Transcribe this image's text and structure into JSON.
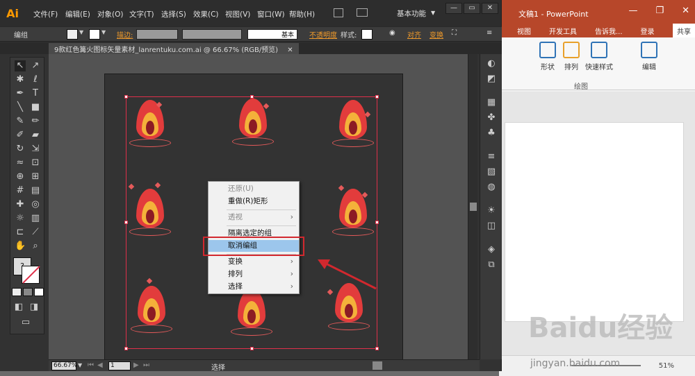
{
  "illustrator": {
    "logo": "Ai",
    "menu": [
      "文件(F)",
      "编辑(E)",
      "对象(O)",
      "文字(T)",
      "选择(S)",
      "效果(C)",
      "视图(V)",
      "窗口(W)",
      "帮助(H)"
    ],
    "workspace": "基本功能",
    "control": {
      "group_label": "编组",
      "stroke_label": "描边:",
      "stroke_style": "基本",
      "opacity_label": "不透明度",
      "style_label": "样式:",
      "align_label": "对齐",
      "transform_label": "变换"
    },
    "document_tab": "9款红色篝火图标矢量素材_lanrentuku.com.ai @ 66.67% (RGB/预览)",
    "status": {
      "zoom": "66.67%",
      "page": "1",
      "tool": "选择"
    },
    "context_menu": [
      {
        "label": "还原(U)",
        "disabled": true,
        "submenu": false
      },
      {
        "label": "重做(R)矩形",
        "disabled": false,
        "submenu": false
      },
      {
        "label": "透视",
        "disabled": true,
        "submenu": true
      },
      {
        "label": "隔离选定的组",
        "disabled": false,
        "submenu": false
      },
      {
        "label": "取消编组",
        "disabled": false,
        "submenu": false,
        "highlighted": true
      },
      {
        "label": "变换",
        "disabled": false,
        "submenu": true
      },
      {
        "label": "排列",
        "disabled": false,
        "submenu": true
      },
      {
        "label": "选择",
        "disabled": false,
        "submenu": true
      }
    ]
  },
  "powerpoint": {
    "title": "文稿1 - PowerPoint",
    "tabs": [
      "视图",
      "开发工具",
      "告诉我...",
      "登录",
      "共享"
    ],
    "ribbon": [
      {
        "label": "形状"
      },
      {
        "label": "排列"
      },
      {
        "label": "快速样式"
      },
      {
        "label": "编辑"
      }
    ],
    "group": "绘图",
    "zoom": "51%"
  },
  "watermark": {
    "brand": "Baidu经验",
    "url": "jingyan.baidu.com"
  },
  "colors": {
    "highlight": "#9cc6ec",
    "annotation_red": "#d2282e",
    "ppt_red": "#b7472a",
    "ai_orange": "#ff9a00"
  }
}
